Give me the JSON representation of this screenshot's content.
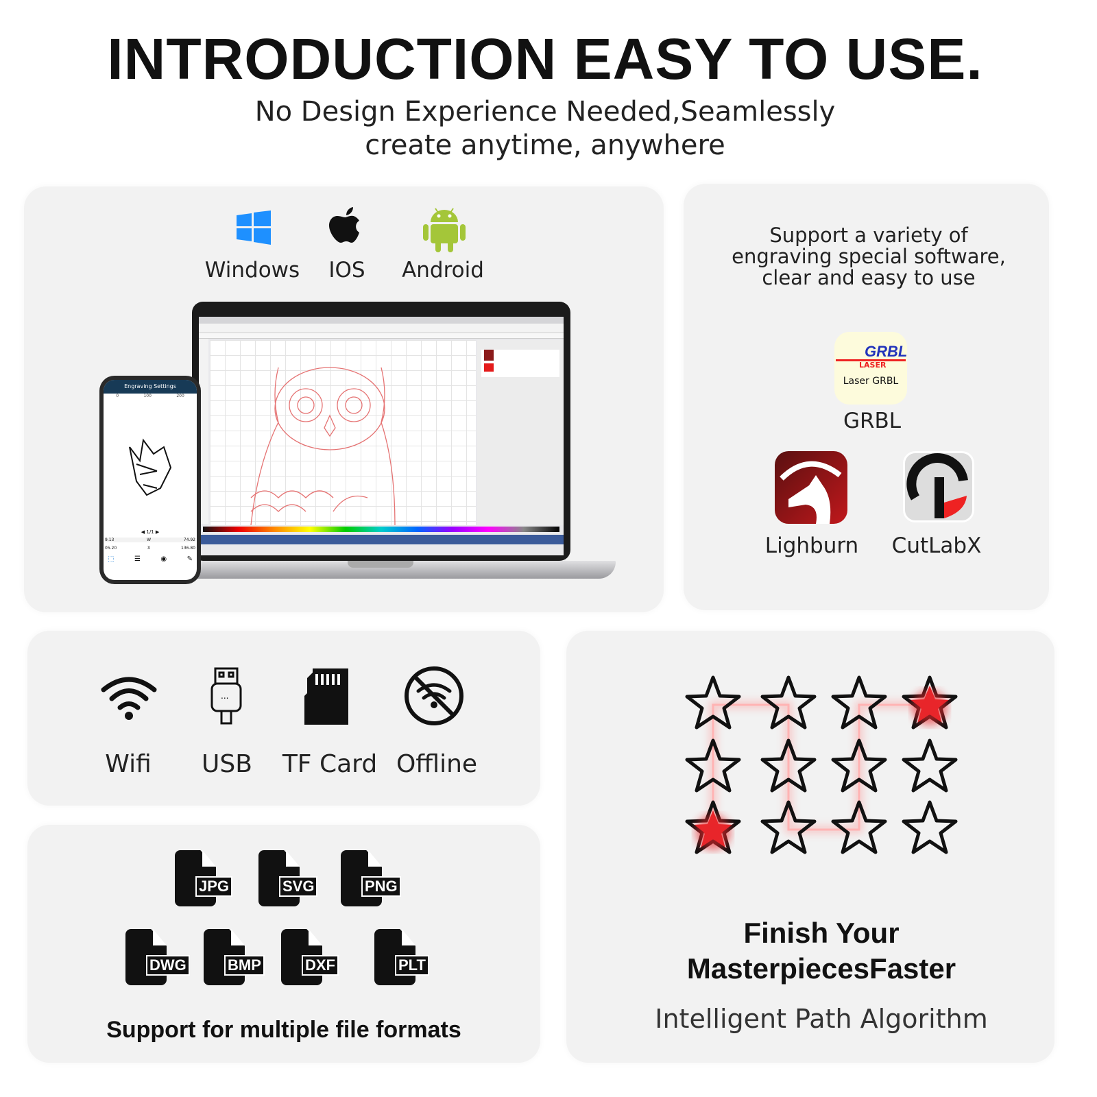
{
  "header": {
    "title": "INTRODUCTION EASY TO USE.",
    "subtitle_line1": "No Design Experience Needed,Seamlessly",
    "subtitle_line2": "create anytime, anywhere"
  },
  "platforms": [
    {
      "label": "Windows",
      "icon": "windows-icon",
      "color": "#1e90ff"
    },
    {
      "label": "IOS",
      "icon": "apple-icon",
      "color": "#111111"
    },
    {
      "label": "Android",
      "icon": "android-icon",
      "color": "#a4c639"
    }
  ],
  "phone": {
    "title": "Engraving Settings",
    "ruler": [
      "0",
      "100",
      "200"
    ],
    "page": "1/1",
    "w": "74.92",
    "x": "136.80",
    "left1": "9.13",
    "left2": "05.20",
    "w_label": "W",
    "x_label": "X"
  },
  "software": {
    "description": [
      "Support a variety of",
      "engraving special software,",
      "clear and easy to use"
    ],
    "items": [
      {
        "label": "GRBL",
        "logo_text": "Laser GRBL"
      },
      {
        "label": "Lighburn"
      },
      {
        "label": "CutLabX"
      }
    ],
    "grbl_logo": {
      "brand": "GRBL",
      "sub": "LASER"
    }
  },
  "connectivity": [
    {
      "label": "Wifi",
      "icon": "wifi-icon"
    },
    {
      "label": "USB",
      "icon": "usb-icon"
    },
    {
      "label": "TF Card",
      "icon": "sd-card-icon"
    },
    {
      "label": "Offline",
      "icon": "offline-icon"
    }
  ],
  "formats": {
    "items": [
      "JPG",
      "SVG",
      "PNG",
      "DWG",
      "BMP",
      "DXF",
      "PLT"
    ],
    "caption": "Support for multiple file formats"
  },
  "path": {
    "title_line1": "Finish Your",
    "title_line2": "MasterpiecesFaster",
    "subtitle": "Intelligent Path Algorithm",
    "laser_color": "#e8252a"
  }
}
